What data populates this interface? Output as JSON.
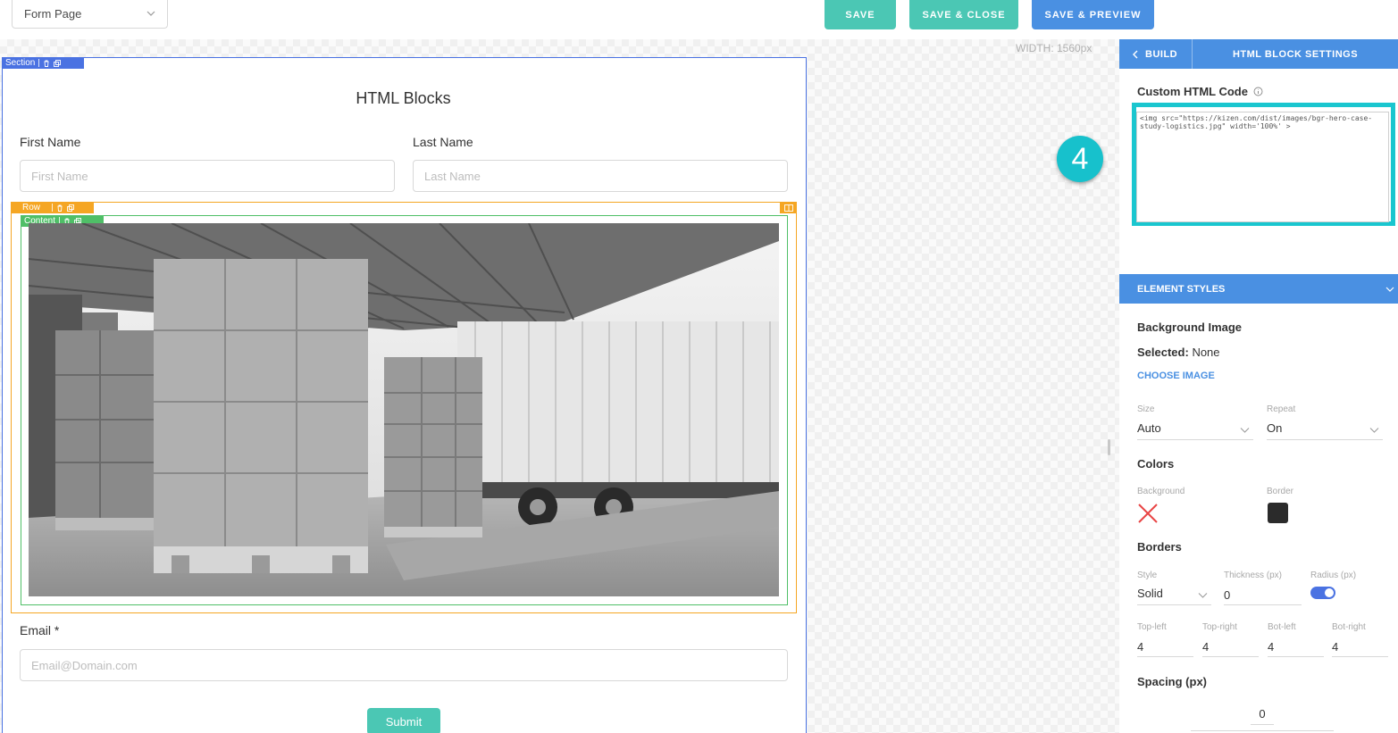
{
  "topbar": {
    "page_select": "Form Page",
    "save_label": "SAVE",
    "save_close_label": "SAVE & CLOSE",
    "save_preview_label": "SAVE & PREVIEW"
  },
  "canvas": {
    "width_label": "WIDTH: 1560px",
    "section_tag": "Section",
    "row_tag": "Row",
    "content_tag": "Content"
  },
  "form": {
    "title": "HTML Blocks",
    "first_name_label": "First Name",
    "first_name_placeholder": "First Name",
    "last_name_label": "Last Name",
    "last_name_placeholder": "Last Name",
    "email_label": "Email  *",
    "email_placeholder": "Email@Domain.com",
    "submit_label": "Submit"
  },
  "panel": {
    "build_label": "BUILD",
    "title": "HTML BLOCK SETTINGS",
    "custom_html_label": "Custom HTML Code",
    "custom_html_code": "<img src=\"https://kizen.com/dist/images/bgr-hero-case-study-logistics.jpg\" width='100%' >",
    "step_badge": "4",
    "element_styles_label": "ELEMENT STYLES",
    "background_image_heading": "Background Image",
    "selected_key": "Selected:",
    "selected_value": "None",
    "choose_image_label": "CHOOSE IMAGE",
    "size_label": "Size",
    "size_value": "Auto",
    "repeat_label": "Repeat",
    "repeat_value": "On",
    "colors_heading": "Colors",
    "background_color_label": "Background",
    "border_color_label": "Border",
    "border_color": "#2b2b2b",
    "borders_heading": "Borders",
    "style_label": "Style",
    "style_value": "Solid",
    "thickness_label": "Thickness (px)",
    "thickness_value": "0",
    "radius_label": "Radius (px)",
    "top_left_label": "Top-left",
    "top_left_value": "4",
    "top_right_label": "Top-right",
    "top_right_value": "4",
    "bot_left_label": "Bot-left",
    "bot_left_value": "4",
    "bot_right_label": "Bot-right",
    "bot_right_value": "4",
    "spacing_heading": "Spacing (px)",
    "spacing_value": "0"
  },
  "colors": {
    "teal": "#4bc7b4",
    "blue": "#4a90e2",
    "section_blue": "#4a72e2",
    "row_orange": "#f5a623",
    "content_green": "#4fbf67",
    "highlight_cyan": "#1ac6cf"
  }
}
